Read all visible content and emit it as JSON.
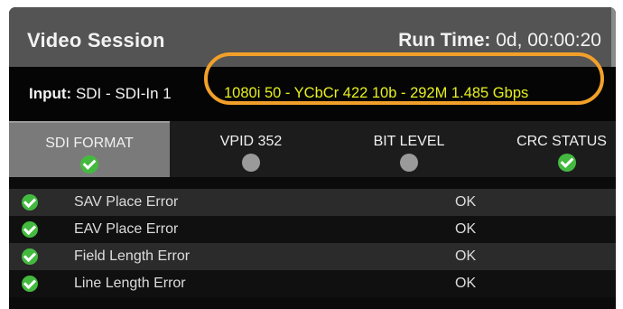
{
  "header": {
    "title": "Video Session",
    "run_time_label": "Run Time:",
    "run_time_value": "0d, 00:00:20"
  },
  "input": {
    "label": "Input:",
    "source": "SDI - SDI-In 1",
    "format": "1080i 50 - YCbCr 422 10b - 292M 1.485 Gbps"
  },
  "colors": {
    "highlight": "#f2a02a",
    "format_text": "#e6f01e",
    "ok_green": "#44b93f",
    "idle_grey": "#9a9a9a"
  },
  "tabs": [
    {
      "label": "SDI FORMAT",
      "status": "check-icon",
      "active": true
    },
    {
      "label": "VPID 352",
      "status": "grey-dot-icon",
      "active": false
    },
    {
      "label": "BIT LEVEL",
      "status": "grey-dot-icon",
      "active": false
    },
    {
      "label": "CRC STATUS",
      "status": "check-icon",
      "active": false
    }
  ],
  "rows": [
    {
      "name": "SAV Place Error",
      "value": "OK",
      "status": "check-icon"
    },
    {
      "name": "EAV Place Error",
      "value": "OK",
      "status": "check-icon"
    },
    {
      "name": "Field Length Error",
      "value": "OK",
      "status": "check-icon"
    },
    {
      "name": "Line Length Error",
      "value": "OK",
      "status": "check-icon"
    }
  ]
}
